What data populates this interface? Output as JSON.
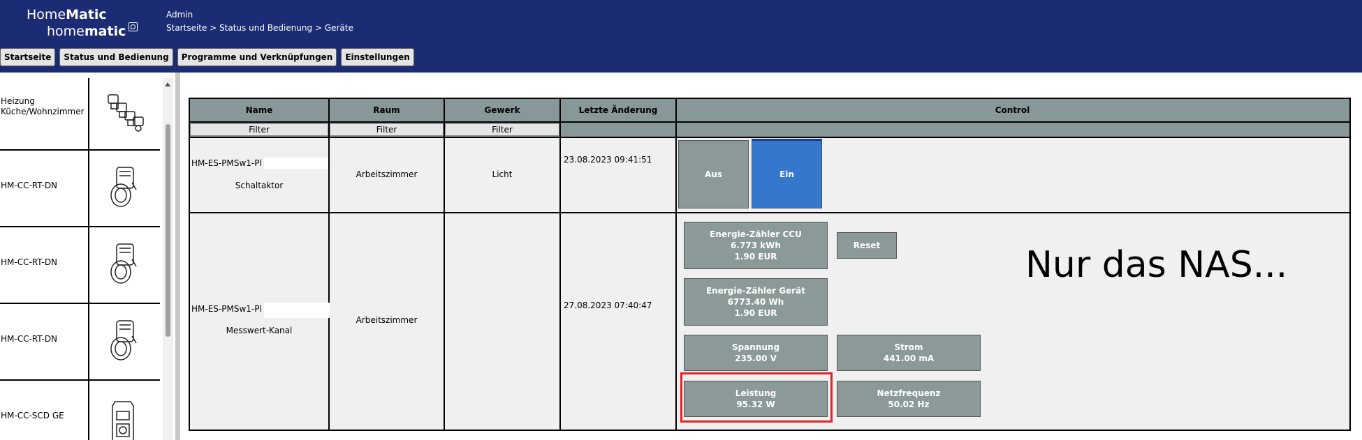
{
  "header": {
    "logo_top_a": "Home",
    "logo_top_b": "Matic",
    "logo_bottom_a": "home",
    "logo_bottom_b": "matic",
    "user": "Admin",
    "breadcrumb": "Startseite > Status und Bedienung > Geräte"
  },
  "menu": [
    {
      "label": "Startseite"
    },
    {
      "label": "Status und Bedienung"
    },
    {
      "label": "Programme und Verknüpfungen"
    },
    {
      "label": "Einstellungen"
    }
  ],
  "sidebar": {
    "items": [
      {
        "name": "Heizung Küche/Wohnzimmer",
        "icon": "heating-group-icon"
      },
      {
        "name": "HM-CC-RT-DN",
        "icon": "radiator-thermostat-icon"
      },
      {
        "name": "HM-CC-RT-DN",
        "icon": "radiator-thermostat-icon"
      },
      {
        "name": "HM-CC-RT-DN",
        "icon": "radiator-thermostat-icon"
      },
      {
        "name": "HM-CC-SCD GE",
        "icon": "co2-sensor-icon"
      }
    ]
  },
  "table": {
    "headers": {
      "name": "Name",
      "raum": "Raum",
      "gewerk": "Gewerk",
      "letzte": "Letzte Änderung",
      "control": "Control"
    },
    "filter_label": "Filter",
    "rows": [
      {
        "name": "HM-ES-PMSw1-Pl",
        "channel": "Schaltaktor",
        "raum": "Arbeitszimmer",
        "gewerk": "Licht",
        "letzte": "23.08.2023 09:41:51",
        "controls": {
          "off": "Aus",
          "on": "Ein"
        }
      },
      {
        "name": "HM-ES-PMSw1-Pl",
        "channel": "Messwert-Kanal",
        "raum": "Arbeitszimmer",
        "gewerk": "",
        "letzte": "27.08.2023 07:40:47",
        "controls": {
          "energy_ccu": {
            "title": "Energie-Zähler CCU",
            "value": "6.773 kWh",
            "cost": "1.90 EUR"
          },
          "reset": "Reset",
          "energy_device": {
            "title": "Energie-Zähler Gerät",
            "value": "6773.40 Wh",
            "cost": "1.90 EUR"
          },
          "voltage": {
            "title": "Spannung",
            "value": "235.00 V"
          },
          "current": {
            "title": "Strom",
            "value": "441.00 mA"
          },
          "power": {
            "title": "Leistung",
            "value": "95.32 W"
          },
          "frequency": {
            "title": "Netzfrequenz",
            "value": "50.02 Hz"
          }
        }
      }
    ]
  },
  "annotation": {
    "text": "Nur das NAS...",
    "highlight_color": "#e0242c"
  },
  "colors": {
    "header_bg": "#1c2c74",
    "tile_bg": "#8b9999",
    "tile_active": "#3577cd",
    "grid_header": "#889898"
  }
}
